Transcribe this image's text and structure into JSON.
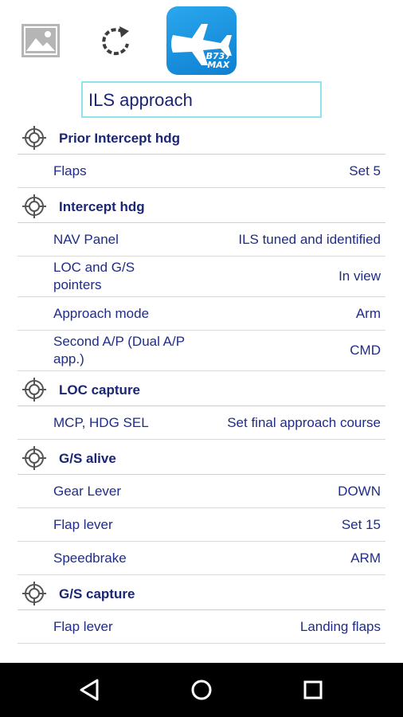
{
  "toolbar": {
    "gallery_icon": "image-gallery-icon",
    "refresh_icon": "refresh-icon",
    "logo": {
      "line1": "B737",
      "line2": "MAX",
      "colors": [
        "#2aa8ee",
        "#0f7fd0"
      ]
    }
  },
  "title": "ILS approach",
  "sections": [
    {
      "header": "Prior Intercept hdg",
      "items": [
        {
          "label": "Flaps",
          "value": "Set 5"
        }
      ]
    },
    {
      "header": "Intercept hdg",
      "items": [
        {
          "label": "NAV Panel",
          "value": "ILS tuned and identified"
        },
        {
          "label": "LOC and G/S pointers",
          "value": "In view"
        },
        {
          "label": "Approach mode",
          "value": "Arm"
        },
        {
          "label": "Second A/P (Dual A/P app.)",
          "value": "CMD"
        }
      ]
    },
    {
      "header": "LOC capture",
      "items": [
        {
          "label": "MCP, HDG SEL",
          "value": "Set final approach course"
        }
      ]
    },
    {
      "header": "G/S alive",
      "items": [
        {
          "label": "Gear Lever",
          "value": "DOWN"
        },
        {
          "label": "Flap lever",
          "value": "Set 15"
        },
        {
          "label": "Speedbrake",
          "value": "ARM"
        }
      ]
    },
    {
      "header": "G/S capture",
      "items": [
        {
          "label": "Flap lever",
          "value": "Landing flaps"
        }
      ]
    }
  ],
  "navbar": {
    "back_icon": "back-triangle-icon",
    "home_icon": "home-circle-icon",
    "recents_icon": "recents-square-icon"
  },
  "colors": {
    "text": "#1f2c8a",
    "title_border": "#8fe3ec",
    "divider": "#d9d9d9",
    "logo_blue": "#1591dc"
  }
}
